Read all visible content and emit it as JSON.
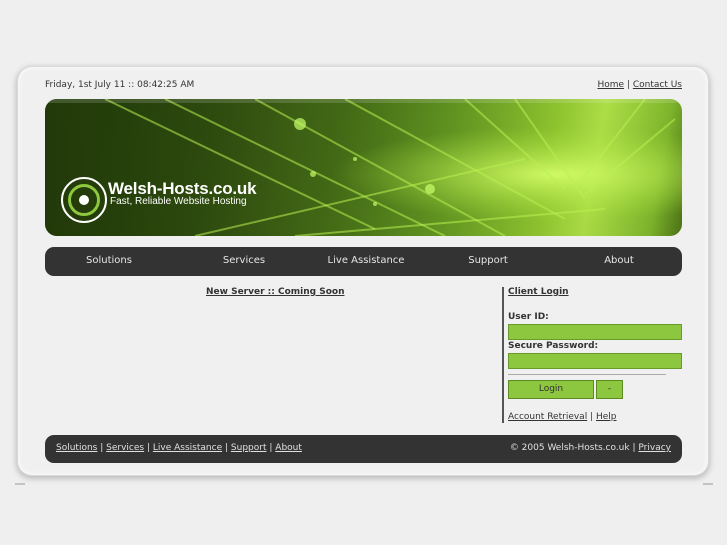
{
  "header": {
    "datetime": "Friday, 1st July 11 :: 08:42:25 AM",
    "links": [
      {
        "label": "Home"
      },
      {
        "label": "Contact Us"
      }
    ],
    "separator": "|"
  },
  "banner": {
    "brand": "Welsh-Hosts.co.uk",
    "tagline": "Fast, Reliable Website Hosting",
    "logo_icon": "target-circle-icon",
    "accent_color": "#8dc63f"
  },
  "nav": {
    "items": [
      {
        "label": "Solutions"
      },
      {
        "label": "Services"
      },
      {
        "label": "Live Assistance"
      },
      {
        "label": "Support"
      },
      {
        "label": "About"
      }
    ]
  },
  "main": {
    "headline": "New Server :: Coming Soon"
  },
  "login": {
    "title": "Client Login",
    "user_label": "User ID:",
    "user_value": "",
    "password_label": "Secure Password:",
    "password_value": "",
    "login_button": "Login",
    "reset_button": "-",
    "links": [
      {
        "label": "Account Retrieval"
      },
      {
        "label": "Help"
      }
    ],
    "separator": "|",
    "field_color": "#8dc63f"
  },
  "footer": {
    "links": [
      {
        "label": "Solutions"
      },
      {
        "label": "Services"
      },
      {
        "label": "Live Assistance"
      },
      {
        "label": "Support"
      },
      {
        "label": "About"
      }
    ],
    "separator": "|",
    "copyright": "© 2005 Welsh-Hosts.co.uk",
    "privacy": "Privacy"
  }
}
